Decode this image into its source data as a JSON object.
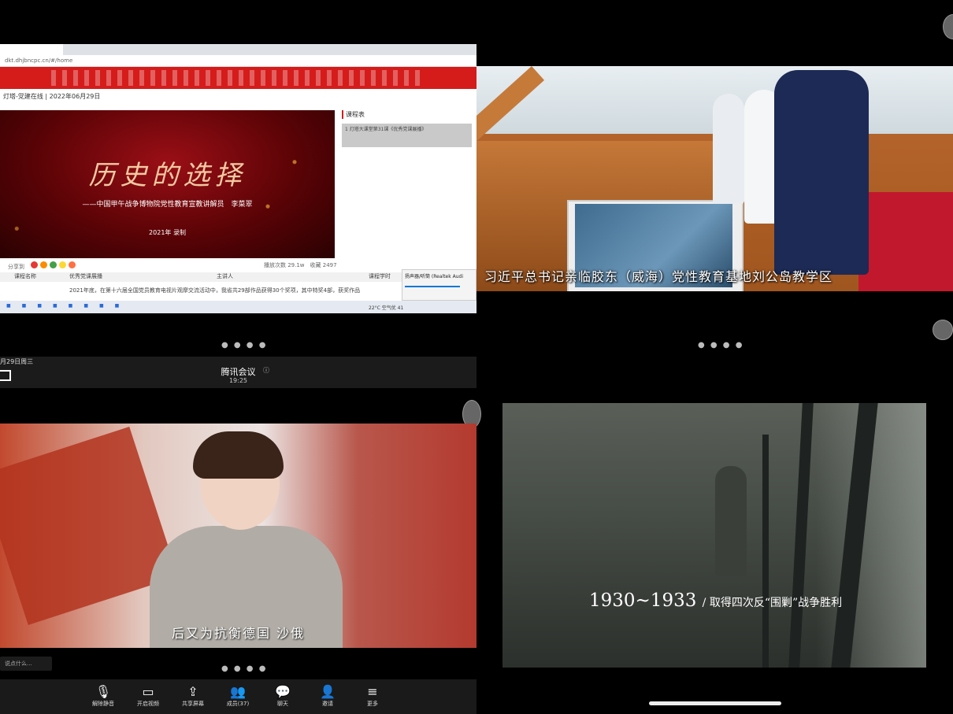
{
  "q1": {
    "address": "dkt.dhjbncpc.cn/#/home",
    "breadcrumb": "灯塔-党建在线 | 2022年06月29日",
    "video_title": "历史的选择",
    "video_subtitle": "——中国甲午战争博物院党性教育宣教讲解员　李菜翠",
    "video_year": "2021年 录制",
    "side_header": "课程表",
    "side_item": "1 灯塔大课堂第31课《优秀党课展播》",
    "meta_left": "分享到",
    "meta_right": "播放次数 29.1w　收藏 2497",
    "table_cols": [
      "课程名称",
      "优秀党课展播",
      "主讲人",
      "课程学时"
    ],
    "paragraph": "2021年底，在第十六届全国党员教育电视片观摩交流活动中，我省共29部作品获得30个奖项，其中特奖4部，获奖作品",
    "audio_popup": "扬声器/听筒 (Realtek Audi",
    "taskbar_status": "22°C 空气优 41",
    "icon_colors": [
      "#e53935",
      "#fb8c00",
      "#43a047",
      "#fdd835",
      "#ff7043"
    ]
  },
  "q2": {
    "caption": "习近平总书记亲临胶东（威海）党性教育基地刘公岛教学区"
  },
  "q3": {
    "date": "月29日周三",
    "app_title": "腾讯会议",
    "time": "19:25",
    "subtitle": "后又为抗衡德国 沙俄",
    "chat_placeholder": "说点什么...",
    "controls": [
      {
        "label": "解除静音",
        "icon": "🎙"
      },
      {
        "label": "开启视频",
        "icon": "▭"
      },
      {
        "label": "共享屏幕",
        "icon": "⇪"
      },
      {
        "label": "成员(37)",
        "icon": "👥"
      },
      {
        "label": "聊天",
        "icon": "💬"
      },
      {
        "label": "邀请",
        "icon": "👤"
      },
      {
        "label": "更多",
        "icon": "≡"
      }
    ]
  },
  "q4": {
    "caption_years": "1930~1933",
    "caption_text": "/ 取得四次反“围剿”战争胜利"
  }
}
